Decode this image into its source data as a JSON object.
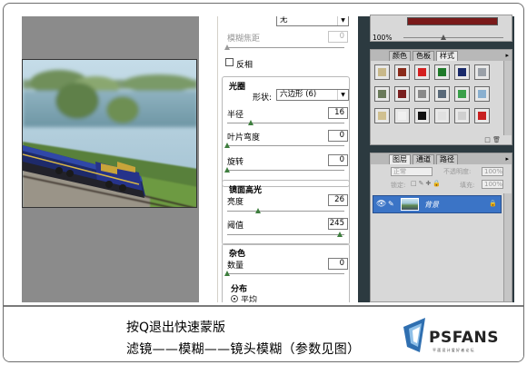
{
  "lens_panel": {
    "iris_select_value": "无",
    "blur_focal_label": "模糊焦距",
    "blur_focal_value": "0",
    "invert_label": "反相",
    "iris_title": "光圈",
    "shape_label": "形状:",
    "shape_value": "六边形 (6)",
    "radius_label": "半径",
    "radius_value": "16",
    "radius_level": 0.2,
    "curvature_label": "叶片弯度",
    "curvature_value": "0",
    "curvature_level": 0.0,
    "rotation_label": "旋转",
    "rotation_value": "0",
    "rotation_level": 0.0,
    "specular_title": "镜面高光",
    "brightness_label": "亮度",
    "brightness_value": "26",
    "brightness_level": 0.26,
    "threshold_label": "阈值",
    "threshold_value": "245",
    "threshold_level": 0.96,
    "noise_title": "杂色",
    "amount_label": "数量",
    "amount_value": "0",
    "amount_level": 0.0,
    "distribution_title": "分布",
    "uniform_label": "平均"
  },
  "navigator": {
    "zoom": "100%"
  },
  "swatches_palette": {
    "tabs": [
      "颜色",
      "色板",
      "样式"
    ],
    "styles": [
      {
        "icon": "style-default-icon",
        "color": "#c8b88a"
      },
      {
        "icon": "style-red-icon",
        "color": "#8a2a1a"
      },
      {
        "icon": "style-bright-red-icon",
        "color": "#d42020"
      },
      {
        "icon": "style-green-icon",
        "color": "#1f7a2a"
      },
      {
        "icon": "style-navy-icon",
        "color": "#1a2a6a"
      },
      {
        "icon": "style-pattern-icon",
        "color": "#9aa0a8"
      },
      {
        "icon": "style-olive-icon",
        "color": "#6a7a5a"
      },
      {
        "icon": "style-maroon-icon",
        "color": "#7a2020"
      },
      {
        "icon": "style-gray-icon",
        "color": "#8a8a8a"
      },
      {
        "icon": "style-blue-gray-icon",
        "color": "#5a6a7a"
      },
      {
        "icon": "style-green-glow-icon",
        "color": "#3aa04a"
      },
      {
        "icon": "style-light-blue-icon",
        "color": "#8ab0d0"
      },
      {
        "icon": "style-tan-icon",
        "color": "#d0c090"
      },
      {
        "icon": "style-white-icon",
        "color": "#f0f0f0"
      },
      {
        "icon": "style-black-icon",
        "color": "#111111"
      },
      {
        "icon": "style-outline-icon",
        "color": "#e0e0e0"
      },
      {
        "icon": "style-frame-icon",
        "color": "#cfcfcf"
      },
      {
        "icon": "style-crimson-icon",
        "color": "#c82020"
      }
    ]
  },
  "layers_palette": {
    "tabs": [
      "图层",
      "通道",
      "路径"
    ],
    "blend_mode": "正常",
    "opacity_label": "不透明度:",
    "opacity_value": "100%",
    "lock_label": "锁定:",
    "fill_label": "填充:",
    "fill_value": "100%",
    "layer_name": "背景"
  },
  "caption": {
    "line1": "按Q退出快速蒙版",
    "line2": "滤镜——模糊——镜头模糊（参数见图）"
  },
  "logo": {
    "text": "PSFANS",
    "subtext": "平面设计爱好者论坛"
  },
  "colors": {
    "accent_blue": "#3b74c6",
    "slider_thumb": "#3e7e3e",
    "dark_panel": "#2c3a40"
  }
}
